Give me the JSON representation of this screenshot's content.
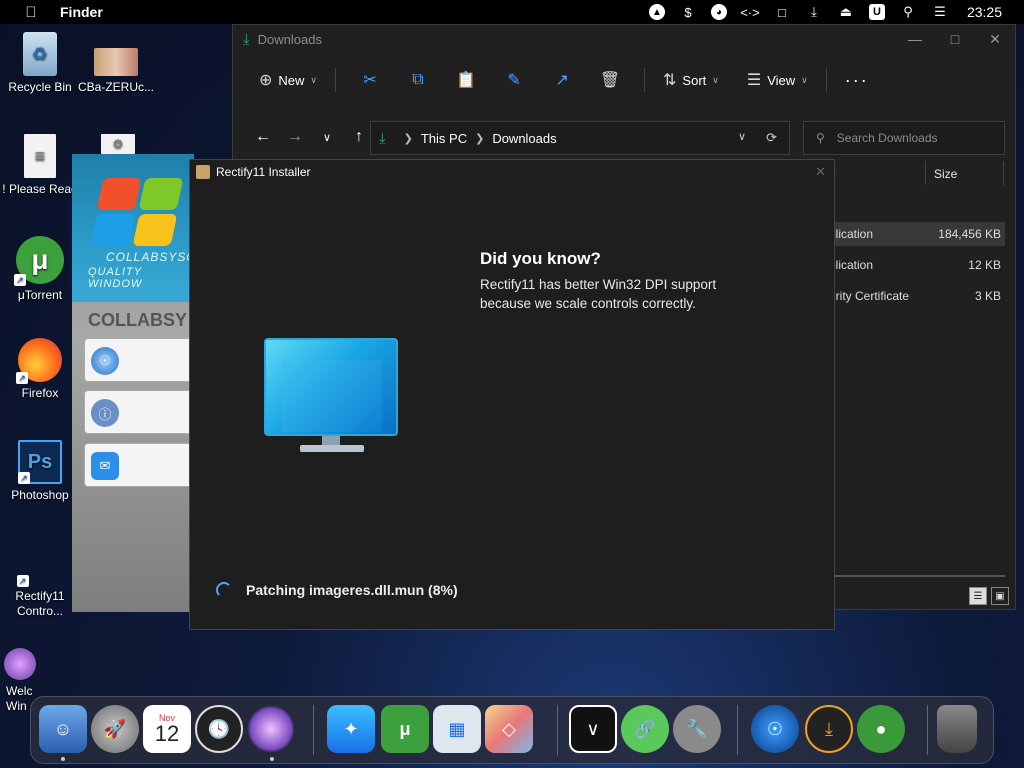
{
  "menubar": {
    "app": "Finder",
    "icons": [
      "eject-icon",
      "dollar-icon",
      "pie-icon",
      "code-icon",
      "display-icon",
      "mute-icon",
      "eject-up-icon",
      "u-icon",
      "search-icon",
      "control-center-icon"
    ],
    "u_label": "U",
    "time": "23:25"
  },
  "desktop": {
    "icons": [
      {
        "label": "Recycle Bin"
      },
      {
        "label": "CBa-ZERUc..."
      },
      {
        "label": "! Please Read"
      },
      {
        "label": "μTorrent"
      },
      {
        "label": "Firefox"
      },
      {
        "label": "Photoshop"
      },
      {
        "label": "Rectify11 Contro..."
      },
      {
        "label": "Welc Win"
      }
    ]
  },
  "explorer": {
    "title": "Downloads",
    "toolbar": {
      "new": "New",
      "sort": "Sort",
      "view": "View"
    },
    "address": {
      "crumb1": "This PC",
      "crumb2": "Downloads"
    },
    "search_placeholder": "Search Downloads",
    "columns": {
      "type": "e",
      "size": "Size"
    },
    "rows": [
      {
        "type": "plication",
        "size": "184,456 KB"
      },
      {
        "type": "plication",
        "size": "12 KB"
      },
      {
        "type": "urity Certificate",
        "size": "3 KB"
      }
    ]
  },
  "collab": {
    "banner1": "COLLABSYSOS",
    "banner2": "QUALITY WINDOW",
    "heading": "COLLABSY"
  },
  "installer": {
    "title": "Rectify11 Installer",
    "tip_title": "Did you know?",
    "tip_text": "Rectify11 has better Win32 DPI support because we scale controls correctly.",
    "status": "Patching imageres.dll.mun (8%)"
  },
  "dock": {
    "calendar_month": "Nov",
    "calendar_day": "12"
  },
  "colors": {
    "accent": "#4da3ff",
    "download_green": "#27a561"
  }
}
